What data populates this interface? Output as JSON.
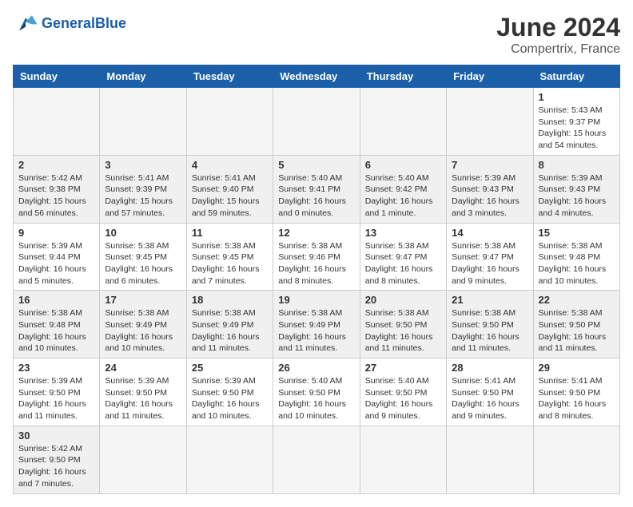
{
  "logo": {
    "text_general": "General",
    "text_blue": "Blue"
  },
  "title": "June 2024",
  "location": "Compertrix, France",
  "days_of_week": [
    "Sunday",
    "Monday",
    "Tuesday",
    "Wednesday",
    "Thursday",
    "Friday",
    "Saturday"
  ],
  "weeks": [
    [
      {
        "day": "",
        "info": ""
      },
      {
        "day": "",
        "info": ""
      },
      {
        "day": "",
        "info": ""
      },
      {
        "day": "",
        "info": ""
      },
      {
        "day": "",
        "info": ""
      },
      {
        "day": "",
        "info": ""
      },
      {
        "day": "1",
        "info": "Sunrise: 5:43 AM\nSunset: 9:37 PM\nDaylight: 15 hours\nand 54 minutes."
      }
    ],
    [
      {
        "day": "2",
        "info": "Sunrise: 5:42 AM\nSunset: 9:38 PM\nDaylight: 15 hours\nand 56 minutes."
      },
      {
        "day": "3",
        "info": "Sunrise: 5:41 AM\nSunset: 9:39 PM\nDaylight: 15 hours\nand 57 minutes."
      },
      {
        "day": "4",
        "info": "Sunrise: 5:41 AM\nSunset: 9:40 PM\nDaylight: 15 hours\nand 59 minutes."
      },
      {
        "day": "5",
        "info": "Sunrise: 5:40 AM\nSunset: 9:41 PM\nDaylight: 16 hours\nand 0 minutes."
      },
      {
        "day": "6",
        "info": "Sunrise: 5:40 AM\nSunset: 9:42 PM\nDaylight: 16 hours\nand 1 minute."
      },
      {
        "day": "7",
        "info": "Sunrise: 5:39 AM\nSunset: 9:43 PM\nDaylight: 16 hours\nand 3 minutes."
      },
      {
        "day": "8",
        "info": "Sunrise: 5:39 AM\nSunset: 9:43 PM\nDaylight: 16 hours\nand 4 minutes."
      }
    ],
    [
      {
        "day": "9",
        "info": "Sunrise: 5:39 AM\nSunset: 9:44 PM\nDaylight: 16 hours\nand 5 minutes."
      },
      {
        "day": "10",
        "info": "Sunrise: 5:38 AM\nSunset: 9:45 PM\nDaylight: 16 hours\nand 6 minutes."
      },
      {
        "day": "11",
        "info": "Sunrise: 5:38 AM\nSunset: 9:45 PM\nDaylight: 16 hours\nand 7 minutes."
      },
      {
        "day": "12",
        "info": "Sunrise: 5:38 AM\nSunset: 9:46 PM\nDaylight: 16 hours\nand 8 minutes."
      },
      {
        "day": "13",
        "info": "Sunrise: 5:38 AM\nSunset: 9:47 PM\nDaylight: 16 hours\nand 8 minutes."
      },
      {
        "day": "14",
        "info": "Sunrise: 5:38 AM\nSunset: 9:47 PM\nDaylight: 16 hours\nand 9 minutes."
      },
      {
        "day": "15",
        "info": "Sunrise: 5:38 AM\nSunset: 9:48 PM\nDaylight: 16 hours\nand 10 minutes."
      }
    ],
    [
      {
        "day": "16",
        "info": "Sunrise: 5:38 AM\nSunset: 9:48 PM\nDaylight: 16 hours\nand 10 minutes."
      },
      {
        "day": "17",
        "info": "Sunrise: 5:38 AM\nSunset: 9:49 PM\nDaylight: 16 hours\nand 10 minutes."
      },
      {
        "day": "18",
        "info": "Sunrise: 5:38 AM\nSunset: 9:49 PM\nDaylight: 16 hours\nand 11 minutes."
      },
      {
        "day": "19",
        "info": "Sunrise: 5:38 AM\nSunset: 9:49 PM\nDaylight: 16 hours\nand 11 minutes."
      },
      {
        "day": "20",
        "info": "Sunrise: 5:38 AM\nSunset: 9:50 PM\nDaylight: 16 hours\nand 11 minutes."
      },
      {
        "day": "21",
        "info": "Sunrise: 5:38 AM\nSunset: 9:50 PM\nDaylight: 16 hours\nand 11 minutes."
      },
      {
        "day": "22",
        "info": "Sunrise: 5:38 AM\nSunset: 9:50 PM\nDaylight: 16 hours\nand 11 minutes."
      }
    ],
    [
      {
        "day": "23",
        "info": "Sunrise: 5:39 AM\nSunset: 9:50 PM\nDaylight: 16 hours\nand 11 minutes."
      },
      {
        "day": "24",
        "info": "Sunrise: 5:39 AM\nSunset: 9:50 PM\nDaylight: 16 hours\nand 11 minutes."
      },
      {
        "day": "25",
        "info": "Sunrise: 5:39 AM\nSunset: 9:50 PM\nDaylight: 16 hours\nand 10 minutes."
      },
      {
        "day": "26",
        "info": "Sunrise: 5:40 AM\nSunset: 9:50 PM\nDaylight: 16 hours\nand 10 minutes."
      },
      {
        "day": "27",
        "info": "Sunrise: 5:40 AM\nSunset: 9:50 PM\nDaylight: 16 hours\nand 9 minutes."
      },
      {
        "day": "28",
        "info": "Sunrise: 5:41 AM\nSunset: 9:50 PM\nDaylight: 16 hours\nand 9 minutes."
      },
      {
        "day": "29",
        "info": "Sunrise: 5:41 AM\nSunset: 9:50 PM\nDaylight: 16 hours\nand 8 minutes."
      }
    ],
    [
      {
        "day": "30",
        "info": "Sunrise: 5:42 AM\nSunset: 9:50 PM\nDaylight: 16 hours\nand 7 minutes."
      },
      {
        "day": "",
        "info": ""
      },
      {
        "day": "",
        "info": ""
      },
      {
        "day": "",
        "info": ""
      },
      {
        "day": "",
        "info": ""
      },
      {
        "day": "",
        "info": ""
      },
      {
        "day": "",
        "info": ""
      }
    ]
  ]
}
